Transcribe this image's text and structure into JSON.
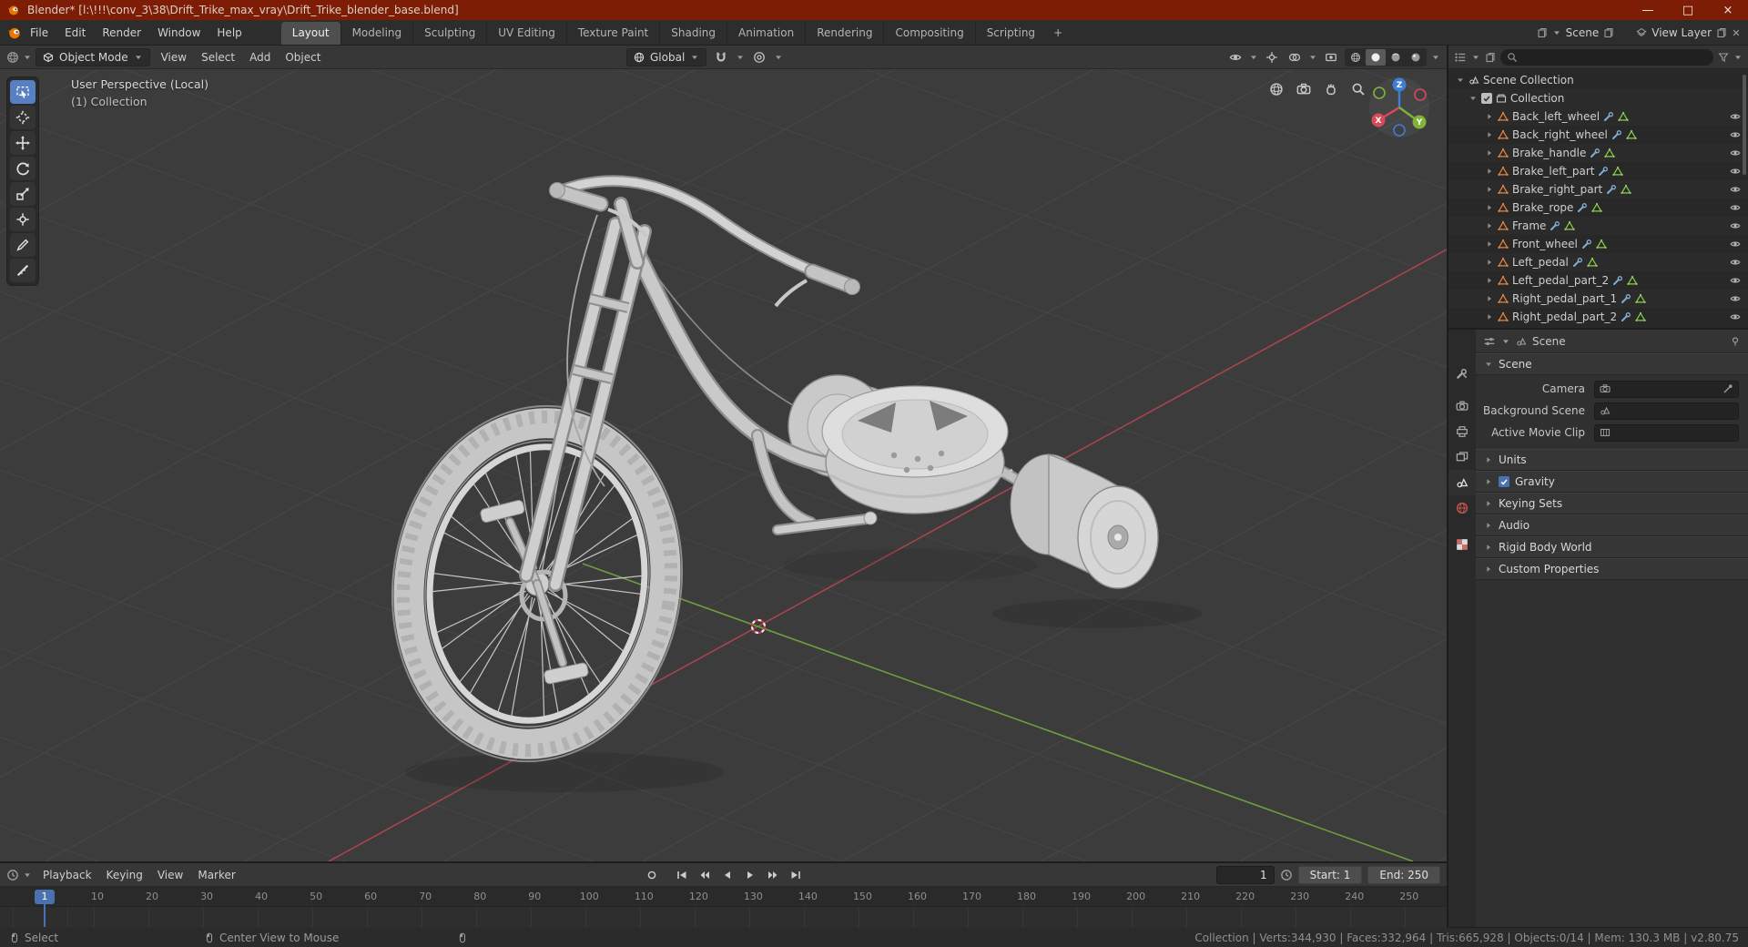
{
  "titlebar": {
    "title": "Blender* [l:\\!!!\\conv_3\\38\\Drift_Trike_max_vray\\Drift_Trike_blender_base.blend]",
    "minimize": "—",
    "maximize": "□",
    "close": "×"
  },
  "topbar": {
    "menus": [
      "File",
      "Edit",
      "Render",
      "Window",
      "Help"
    ],
    "workspaces": [
      "Layout",
      "Modeling",
      "Sculpting",
      "UV Editing",
      "Texture Paint",
      "Shading",
      "Animation",
      "Rendering",
      "Compositing",
      "Scripting"
    ],
    "add_tab": "+",
    "scene_selector": "Scene",
    "view_layer_selector": "View Layer"
  },
  "viewport_header": {
    "mode": "Object Mode",
    "menus": [
      "View",
      "Select",
      "Add",
      "Object"
    ],
    "orientation": "Global"
  },
  "viewport": {
    "overlay_line1": "User Perspective (Local)",
    "overlay_line2": "(1) Collection",
    "axis_x": "X",
    "axis_y": "Y",
    "axis_z": "Z"
  },
  "outliner": {
    "root": "Scene Collection",
    "collection": "Collection",
    "objects": [
      "Back_left_wheel",
      "Back_right_wheel",
      "Brake_handle",
      "Brake_left_part",
      "Brake_right_part",
      "Brake_rope",
      "Frame",
      "Front_wheel",
      "Left_pedal",
      "Left_pedal_part_2",
      "Right_pedal_part_1",
      "Right_pedal_part_2"
    ]
  },
  "properties": {
    "breadcrumb": "Scene",
    "scene_panel": "Scene",
    "camera_label": "Camera",
    "background_scene_label": "Background Scene",
    "active_movie_clip_label": "Active Movie Clip",
    "units_panel": "Units",
    "gravity_panel": "Gravity",
    "keying_sets_panel": "Keying Sets",
    "audio_panel": "Audio",
    "rigid_body_panel": "Rigid Body World",
    "custom_properties_panel": "Custom Properties"
  },
  "timeline": {
    "menus": [
      "Playback",
      "Keying",
      "View",
      "Marker"
    ],
    "current_frame": "1",
    "frame_field": "1",
    "start_field": "Start: 1",
    "end_field": "End: 250",
    "ticks": [
      "10",
      "20",
      "30",
      "40",
      "50",
      "60",
      "70",
      "80",
      "90",
      "100",
      "110",
      "120",
      "130",
      "140",
      "150",
      "160",
      "170",
      "180",
      "190",
      "200",
      "210",
      "220",
      "230",
      "240",
      "250"
    ]
  },
  "statusbar": {
    "select_hint": "Select",
    "center_hint": "Center View to Mouse",
    "stats": "Collection | Verts:344,930 | Faces:332,964 | Tris:665,928 | Objects:0/14 | Mem: 130.3 MB | v2.80.75"
  },
  "colors": {
    "accent_blue": "#4a72b0",
    "titlebar_red": "#7e1d05",
    "blender_orange": "#ea7600",
    "mesh_icon_orange": "#e8853c",
    "mesh_data_green": "#8fce53",
    "modifier_blue": "#84aed4",
    "axis_x_red": "#d64a5a",
    "axis_y_green": "#7fb439",
    "axis_z_blue": "#3d7fd4"
  }
}
